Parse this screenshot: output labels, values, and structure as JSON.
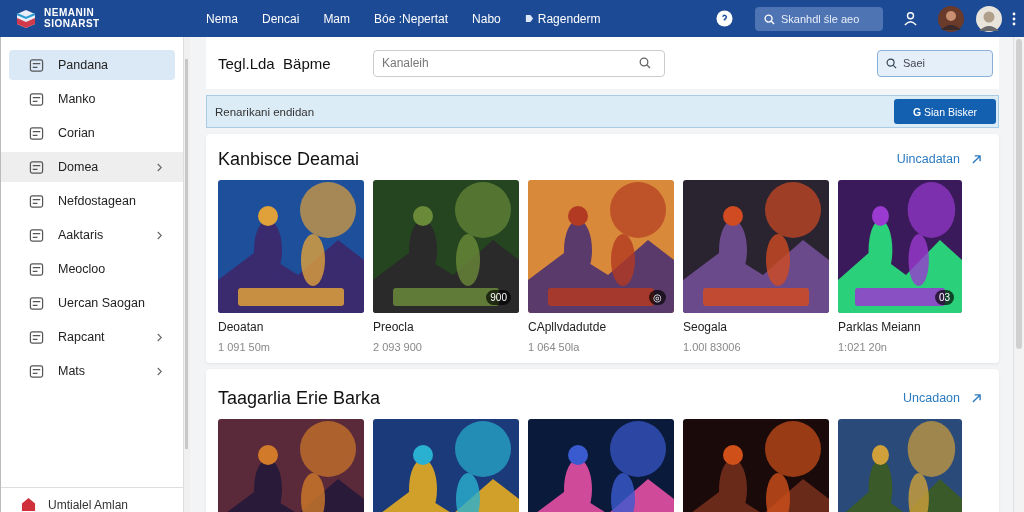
{
  "header": {
    "logo": "NEMANIN SIONARST",
    "nav": [
      {
        "label": "Nema",
        "icon": false
      },
      {
        "label": "Dencai",
        "icon": false
      },
      {
        "label": "Mam",
        "icon": false
      },
      {
        "label": "Bóe :Nepertat",
        "icon": false
      },
      {
        "label": "Nabo",
        "icon": false
      },
      {
        "label": "Ragenderm",
        "icon": true
      }
    ],
    "search": {
      "placeholder": "Skanhdl śle aeo"
    }
  },
  "sidebar": {
    "items": [
      {
        "label": "Pandana",
        "selected": true,
        "hovered": false,
        "has_children": false
      },
      {
        "label": "Manko",
        "selected": false,
        "hovered": false,
        "has_children": false
      },
      {
        "label": "Corian",
        "selected": false,
        "hovered": false,
        "has_children": false
      },
      {
        "label": "Domea",
        "selected": false,
        "hovered": true,
        "has_children": true
      },
      {
        "label": "Nefdostagean",
        "selected": false,
        "hovered": false,
        "has_children": false
      },
      {
        "label": "Aaktaris",
        "selected": false,
        "hovered": false,
        "has_children": true
      },
      {
        "label": "Meocloo",
        "selected": false,
        "hovered": false,
        "has_children": false
      },
      {
        "label": "Uercan Saogan",
        "selected": false,
        "hovered": false,
        "has_children": false
      },
      {
        "label": "Rapcant",
        "selected": false,
        "hovered": false,
        "has_children": true
      },
      {
        "label": "Mats",
        "selected": false,
        "hovered": false,
        "has_children": true
      }
    ],
    "footer": "Umtialel Amlan"
  },
  "toolbar": {
    "title": "Tegl.Lda  Bäpme",
    "search": {
      "placeholder": "Kanaleih"
    },
    "search_button": "Saei"
  },
  "banner": {
    "text": "Renarikani endidan",
    "button": "Sian Bisker",
    "button_icon": "G"
  },
  "sections": [
    {
      "title": "Kanbisce Deamai",
      "link": "Uincadatan",
      "games": [
        {
          "title": "Deoatan",
          "subtitle": "1 091 50m"
        },
        {
          "title": "Preocla",
          "subtitle": "2 093 900",
          "badge": "900"
        },
        {
          "title": "CApllvdadutde",
          "subtitle": "1 064 50la",
          "badge": "◎"
        },
        {
          "title": "Seogala",
          "subtitle": "1.00l 83006"
        },
        {
          "title": "Parklas Meiann",
          "subtitle": "1:021 20n",
          "badge": "03"
        }
      ]
    },
    {
      "title": "Taagarlia Erie Barka",
      "link": "Uncadaon"
    }
  ]
}
